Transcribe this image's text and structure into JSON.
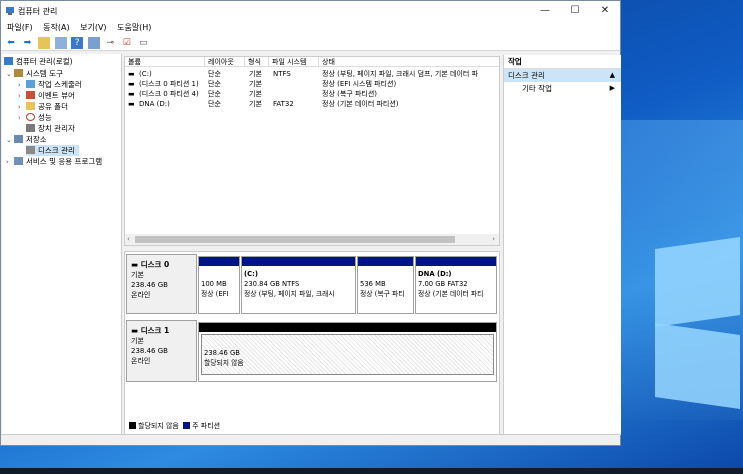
{
  "window": {
    "title": "컴퓨터 관리"
  },
  "menu": [
    "파일(F)",
    "동작(A)",
    "보기(V)",
    "도움말(H)"
  ],
  "tree": {
    "root": "컴퓨터 관리(로컬)",
    "system_tools": "시스템 도구",
    "task_scheduler": "작업 스케줄러",
    "event_viewer": "이벤트 뷰어",
    "shared_folders": "공유 폴더",
    "performance": "성능",
    "device_manager": "장치 관리자",
    "storage": "저장소",
    "disk_management": "디스크 관리",
    "services": "서비스 및 응용 프로그램"
  },
  "volumes": {
    "columns": [
      "볼륨",
      "레이아웃",
      "형식",
      "파일 시스템",
      "상태"
    ],
    "rows": [
      {
        "name": "(C:)",
        "layout": "단순",
        "type": "기본",
        "fs": "NTFS",
        "status": "정상 (부팅, 페이지 파일, 크래시 덤프, 기본 데이터 파"
      },
      {
        "name": "(디스크 0 파티션 1)",
        "layout": "단순",
        "type": "기본",
        "fs": "",
        "status": "정상 (EFI 시스템 파티션)"
      },
      {
        "name": "(디스크 0 파티션 4)",
        "layout": "단순",
        "type": "기본",
        "fs": "",
        "status": "정상 (복구 파티션)"
      },
      {
        "name": "DNA (D:)",
        "layout": "단순",
        "type": "기본",
        "fs": "FAT32",
        "status": "정상 (기본 데이터 파티션)"
      }
    ]
  },
  "disks": [
    {
      "name": "디스크 0",
      "kind": "기본",
      "size": "238.46 GB",
      "state": "온라인",
      "partitions": [
        {
          "title": "",
          "size": "100 MB",
          "status": "정상 (EFI"
        },
        {
          "title": "(C:)",
          "size": "230.84 GB NTFS",
          "status": "정상 (부팅, 페이지 파일, 크래시"
        },
        {
          "title": "",
          "size": "536 MB",
          "status": "정상 (복구 파티"
        },
        {
          "title": "DNA  (D:)",
          "size": "7.00 GB FAT32",
          "status": "정상 (기본 데이터 파티"
        }
      ]
    },
    {
      "name": "디스크 1",
      "kind": "기본",
      "size": "238.46 GB",
      "state": "온라인",
      "partitions": [
        {
          "title": "",
          "size": "238.46 GB",
          "status": "할당되지 않음"
        }
      ]
    }
  ],
  "legend": {
    "unallocated": "할당되지 않음",
    "primary": "주 파티션",
    "unallocated_color": "#000000",
    "primary_color": "#001484"
  },
  "actions": {
    "header": "작업",
    "section": "디스크 관리",
    "more": "기타 작업"
  }
}
